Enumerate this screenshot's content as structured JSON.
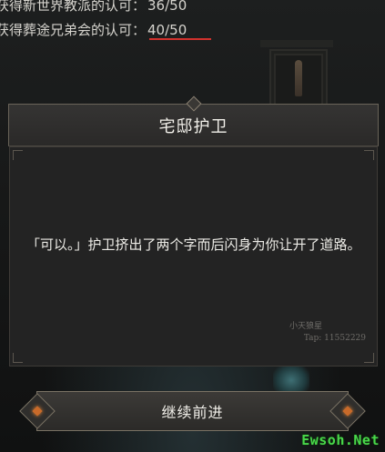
{
  "progress": [
    {
      "label": "获得新世界教派的认可：",
      "value": "36/50",
      "highlight": false
    },
    {
      "label": "获得葬途兄弟会的认可：",
      "value": "40/50",
      "highlight": true
    }
  ],
  "dialog": {
    "title": "宅邸护卫",
    "text": "「可以。」护卫挤出了两个字而后闪身为你让开了道路。",
    "watermark_name": "小天狼星",
    "watermark_id": "Tap: 11552229"
  },
  "continue_label": "继续前进",
  "site_watermark": "Ewsoh.Net",
  "colors": {
    "highlight_underline": "#d2322d",
    "button_gem": "#c86a2a",
    "site_watermark": "#49d84a"
  }
}
